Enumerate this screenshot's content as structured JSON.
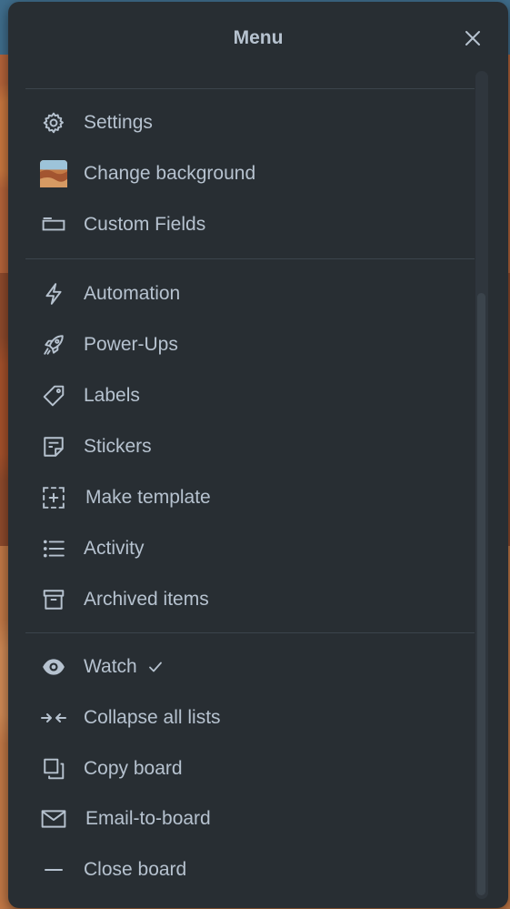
{
  "menu": {
    "title": "Menu",
    "sections": [
      {
        "items": [
          {
            "label": "Settings",
            "icon": "gear-icon"
          },
          {
            "label": "Change background",
            "icon": "background-thumbnail"
          },
          {
            "label": "Custom Fields",
            "icon": "custom-fields-icon"
          }
        ]
      },
      {
        "items": [
          {
            "label": "Automation",
            "icon": "lightning-icon"
          },
          {
            "label": "Power-Ups",
            "icon": "rocket-icon"
          },
          {
            "label": "Labels",
            "icon": "tag-icon"
          },
          {
            "label": "Stickers",
            "icon": "sticker-icon"
          },
          {
            "label": "Make template",
            "icon": "template-icon"
          },
          {
            "label": "Activity",
            "icon": "list-icon"
          },
          {
            "label": "Archived items",
            "icon": "archive-icon"
          }
        ]
      },
      {
        "items": [
          {
            "label": "Watch",
            "icon": "eye-icon",
            "checked": true
          },
          {
            "label": "Collapse all lists",
            "icon": "collapse-icon"
          },
          {
            "label": "Copy board",
            "icon": "copy-icon"
          },
          {
            "label": "Email-to-board",
            "icon": "envelope-icon"
          },
          {
            "label": "Close board",
            "icon": "minus-icon"
          }
        ]
      }
    ]
  },
  "colors": {
    "panel": "#282e33",
    "text": "#b6c2cf",
    "divider": "#3b444c"
  }
}
